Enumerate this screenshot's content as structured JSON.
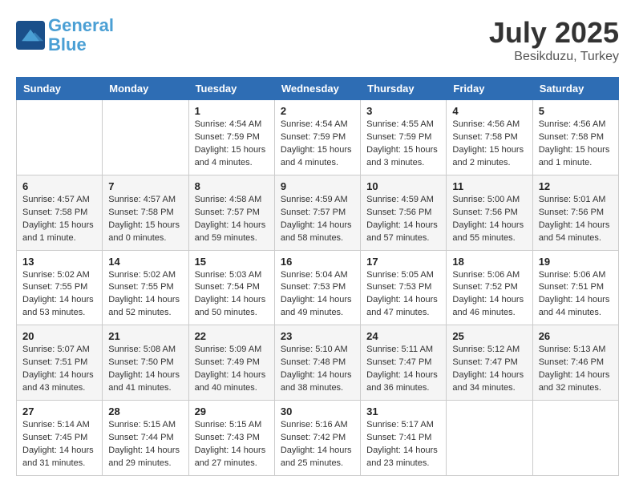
{
  "header": {
    "logo_line1": "General",
    "logo_line2": "Blue",
    "month_year": "July 2025",
    "location": "Besikduzu, Turkey"
  },
  "weekdays": [
    "Sunday",
    "Monday",
    "Tuesday",
    "Wednesday",
    "Thursday",
    "Friday",
    "Saturday"
  ],
  "weeks": [
    [
      {
        "day": "",
        "info": ""
      },
      {
        "day": "",
        "info": ""
      },
      {
        "day": "1",
        "info": "Sunrise: 4:54 AM\nSunset: 7:59 PM\nDaylight: 15 hours and 4 minutes."
      },
      {
        "day": "2",
        "info": "Sunrise: 4:54 AM\nSunset: 7:59 PM\nDaylight: 15 hours and 4 minutes."
      },
      {
        "day": "3",
        "info": "Sunrise: 4:55 AM\nSunset: 7:59 PM\nDaylight: 15 hours and 3 minutes."
      },
      {
        "day": "4",
        "info": "Sunrise: 4:56 AM\nSunset: 7:58 PM\nDaylight: 15 hours and 2 minutes."
      },
      {
        "day": "5",
        "info": "Sunrise: 4:56 AM\nSunset: 7:58 PM\nDaylight: 15 hours and 1 minute."
      }
    ],
    [
      {
        "day": "6",
        "info": "Sunrise: 4:57 AM\nSunset: 7:58 PM\nDaylight: 15 hours and 1 minute."
      },
      {
        "day": "7",
        "info": "Sunrise: 4:57 AM\nSunset: 7:58 PM\nDaylight: 15 hours and 0 minutes."
      },
      {
        "day": "8",
        "info": "Sunrise: 4:58 AM\nSunset: 7:57 PM\nDaylight: 14 hours and 59 minutes."
      },
      {
        "day": "9",
        "info": "Sunrise: 4:59 AM\nSunset: 7:57 PM\nDaylight: 14 hours and 58 minutes."
      },
      {
        "day": "10",
        "info": "Sunrise: 4:59 AM\nSunset: 7:56 PM\nDaylight: 14 hours and 57 minutes."
      },
      {
        "day": "11",
        "info": "Sunrise: 5:00 AM\nSunset: 7:56 PM\nDaylight: 14 hours and 55 minutes."
      },
      {
        "day": "12",
        "info": "Sunrise: 5:01 AM\nSunset: 7:56 PM\nDaylight: 14 hours and 54 minutes."
      }
    ],
    [
      {
        "day": "13",
        "info": "Sunrise: 5:02 AM\nSunset: 7:55 PM\nDaylight: 14 hours and 53 minutes."
      },
      {
        "day": "14",
        "info": "Sunrise: 5:02 AM\nSunset: 7:55 PM\nDaylight: 14 hours and 52 minutes."
      },
      {
        "day": "15",
        "info": "Sunrise: 5:03 AM\nSunset: 7:54 PM\nDaylight: 14 hours and 50 minutes."
      },
      {
        "day": "16",
        "info": "Sunrise: 5:04 AM\nSunset: 7:53 PM\nDaylight: 14 hours and 49 minutes."
      },
      {
        "day": "17",
        "info": "Sunrise: 5:05 AM\nSunset: 7:53 PM\nDaylight: 14 hours and 47 minutes."
      },
      {
        "day": "18",
        "info": "Sunrise: 5:06 AM\nSunset: 7:52 PM\nDaylight: 14 hours and 46 minutes."
      },
      {
        "day": "19",
        "info": "Sunrise: 5:06 AM\nSunset: 7:51 PM\nDaylight: 14 hours and 44 minutes."
      }
    ],
    [
      {
        "day": "20",
        "info": "Sunrise: 5:07 AM\nSunset: 7:51 PM\nDaylight: 14 hours and 43 minutes."
      },
      {
        "day": "21",
        "info": "Sunrise: 5:08 AM\nSunset: 7:50 PM\nDaylight: 14 hours and 41 minutes."
      },
      {
        "day": "22",
        "info": "Sunrise: 5:09 AM\nSunset: 7:49 PM\nDaylight: 14 hours and 40 minutes."
      },
      {
        "day": "23",
        "info": "Sunrise: 5:10 AM\nSunset: 7:48 PM\nDaylight: 14 hours and 38 minutes."
      },
      {
        "day": "24",
        "info": "Sunrise: 5:11 AM\nSunset: 7:47 PM\nDaylight: 14 hours and 36 minutes."
      },
      {
        "day": "25",
        "info": "Sunrise: 5:12 AM\nSunset: 7:47 PM\nDaylight: 14 hours and 34 minutes."
      },
      {
        "day": "26",
        "info": "Sunrise: 5:13 AM\nSunset: 7:46 PM\nDaylight: 14 hours and 32 minutes."
      }
    ],
    [
      {
        "day": "27",
        "info": "Sunrise: 5:14 AM\nSunset: 7:45 PM\nDaylight: 14 hours and 31 minutes."
      },
      {
        "day": "28",
        "info": "Sunrise: 5:15 AM\nSunset: 7:44 PM\nDaylight: 14 hours and 29 minutes."
      },
      {
        "day": "29",
        "info": "Sunrise: 5:15 AM\nSunset: 7:43 PM\nDaylight: 14 hours and 27 minutes."
      },
      {
        "day": "30",
        "info": "Sunrise: 5:16 AM\nSunset: 7:42 PM\nDaylight: 14 hours and 25 minutes."
      },
      {
        "day": "31",
        "info": "Sunrise: 5:17 AM\nSunset: 7:41 PM\nDaylight: 14 hours and 23 minutes."
      },
      {
        "day": "",
        "info": ""
      },
      {
        "day": "",
        "info": ""
      }
    ]
  ]
}
